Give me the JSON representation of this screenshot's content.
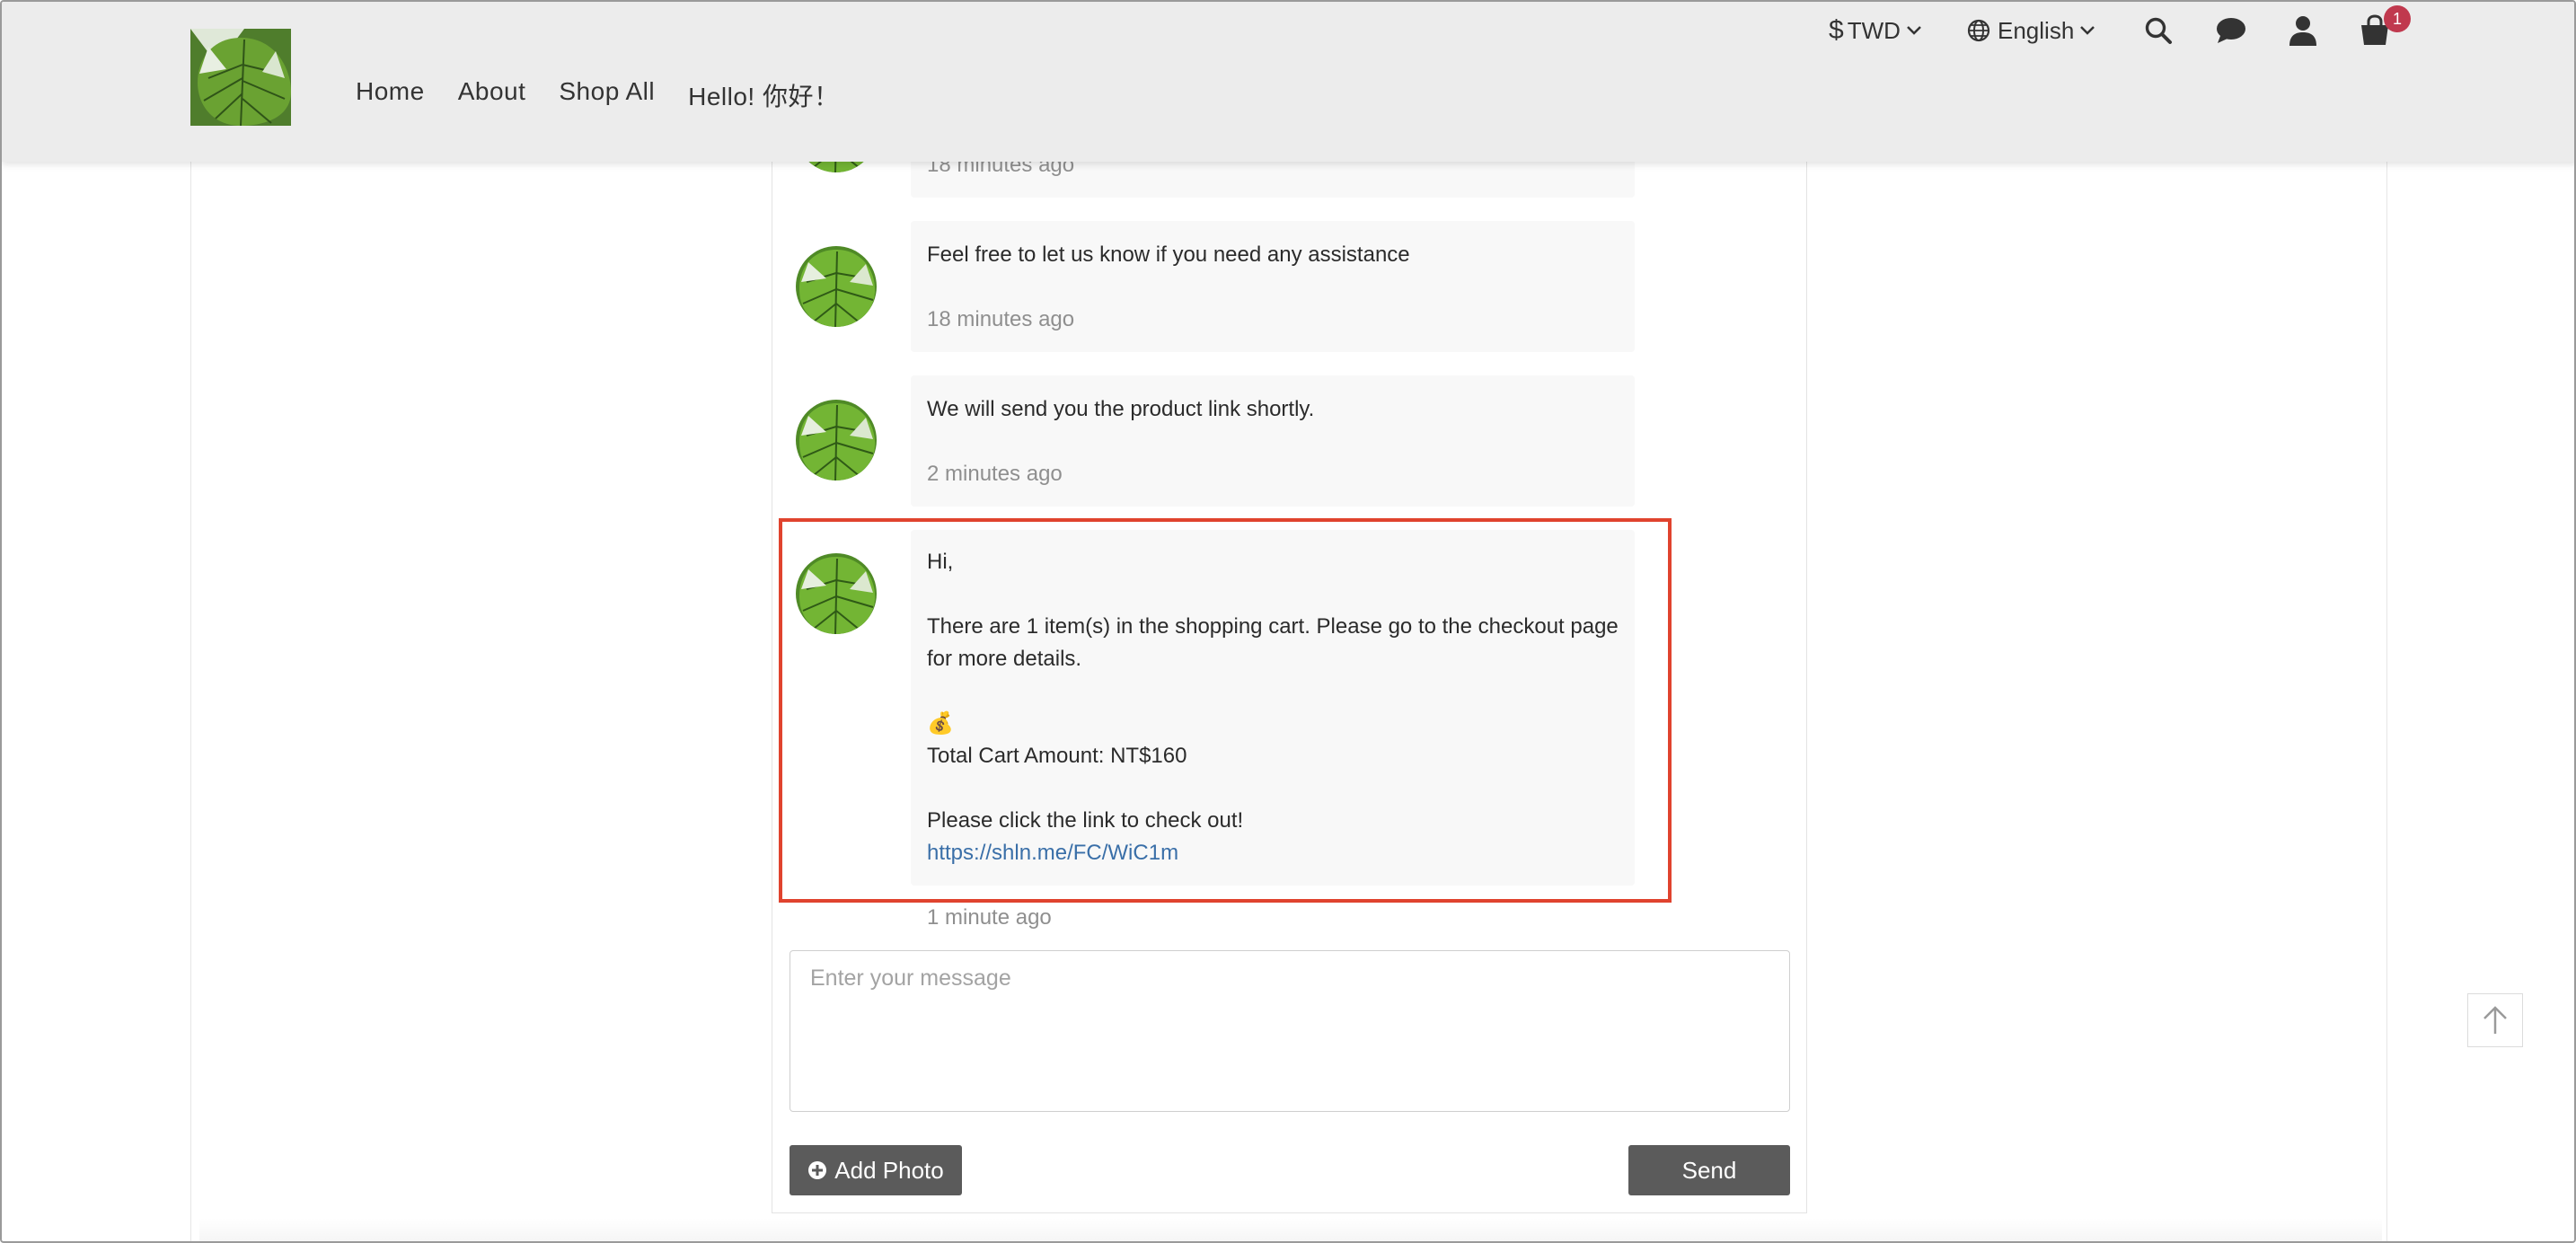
{
  "header": {
    "nav": [
      "Home",
      "About",
      "Shop All",
      "Hello! 你好！"
    ],
    "currency": {
      "symbol": "$",
      "code": "TWD"
    },
    "language": "English",
    "cart_count": "1",
    "icons": [
      "globe-icon",
      "search-icon",
      "chat-icon",
      "user-icon",
      "cart-icon",
      "chevron-down-icon"
    ]
  },
  "messages": [
    {
      "text": "",
      "time": "18 minutes ago"
    },
    {
      "text": "Feel free to let us know if you need any assistance",
      "time": "18 minutes ago"
    },
    {
      "text": "We will send you the product link shortly.",
      "time": "2 minutes ago"
    },
    {
      "greeting": "Hi,",
      "cart_info": "There are 1 item(s) in the shopping cart. Please go to the checkout page for more details.",
      "amount_emoji": "💰",
      "amount": "Total Cart Amount: NT$160",
      "cta": "Please click the link to check out!",
      "link": "https://shln.me/FC/WiC1m",
      "time": "1 minute ago"
    }
  ],
  "composer": {
    "placeholder": "Enter your message",
    "add_photo_label": "Add Photo",
    "send_label": "Send"
  },
  "colors": {
    "header_bg": "#ececec",
    "button_bg": "#5b5b5b",
    "badge": "#c0394e",
    "highlight": "#e0432e",
    "link": "#3a6fa8"
  }
}
